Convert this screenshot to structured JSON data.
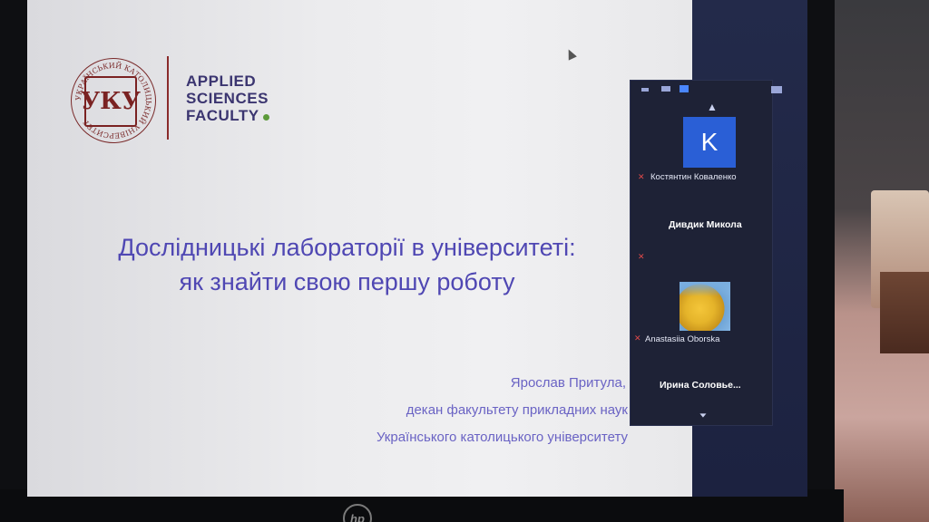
{
  "slide": {
    "university_seal_text": "УКРАЇНСЬКИЙ КАТОЛИЦЬКИЙ УНІВЕРСИТЕТ",
    "seal_monogram": "УКУ",
    "faculty_lines": [
      "APPLIED",
      "SCIENCES",
      "FACULTY"
    ],
    "title_line1": "Дослідницькі лабораторії в університеті:",
    "title_line2": "як знайти свою першу роботу",
    "author_name": "Ярослав Притула,",
    "author_role": "декан факультету прикладних наук",
    "author_university": "Українського католицького університету"
  },
  "video_panel": {
    "participants": [
      {
        "name": "Костянтин Коваленко",
        "avatar_letter": "K",
        "muted": true
      },
      {
        "name": "Дивдик Микола",
        "muted": true
      },
      {
        "name": "Anastasiia Oborska",
        "muted": true
      },
      {
        "name": "Ирина  Соловье..."
      }
    ]
  },
  "monitor": {
    "brand": "hp"
  },
  "colors": {
    "title": "#4f47b3",
    "faculty_text": "#3b3570",
    "accent_green": "#5c9a3a",
    "seal_red": "#7a2222",
    "panel_bg": "#1e2236",
    "avatar_blue": "#2a5fd6"
  }
}
